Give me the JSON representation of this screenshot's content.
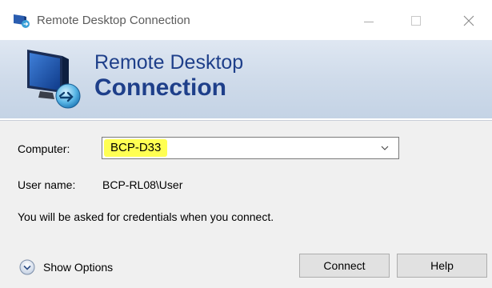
{
  "window": {
    "title": "Remote Desktop Connection",
    "close_glyph": "✕"
  },
  "banner": {
    "title_line1": "Remote Desktop",
    "title_line2": "Connection"
  },
  "form": {
    "computer_label": "Computer:",
    "computer_value": "BCP-D33",
    "user_label": "User name:",
    "user_value": "BCP-RL08\\User",
    "info": "You will be asked for credentials when you connect."
  },
  "footer": {
    "show_options": "Show Options",
    "connect": "Connect",
    "help": "Help"
  },
  "colors": {
    "highlight": "#ffff52",
    "banner_title": "#1e3f8a"
  },
  "icons": [
    "rdp-app-icon",
    "minimize-icon",
    "maximize-icon",
    "close-icon",
    "rdp-monitor-icon",
    "chevron-down-icon",
    "expand-options-icon"
  ]
}
